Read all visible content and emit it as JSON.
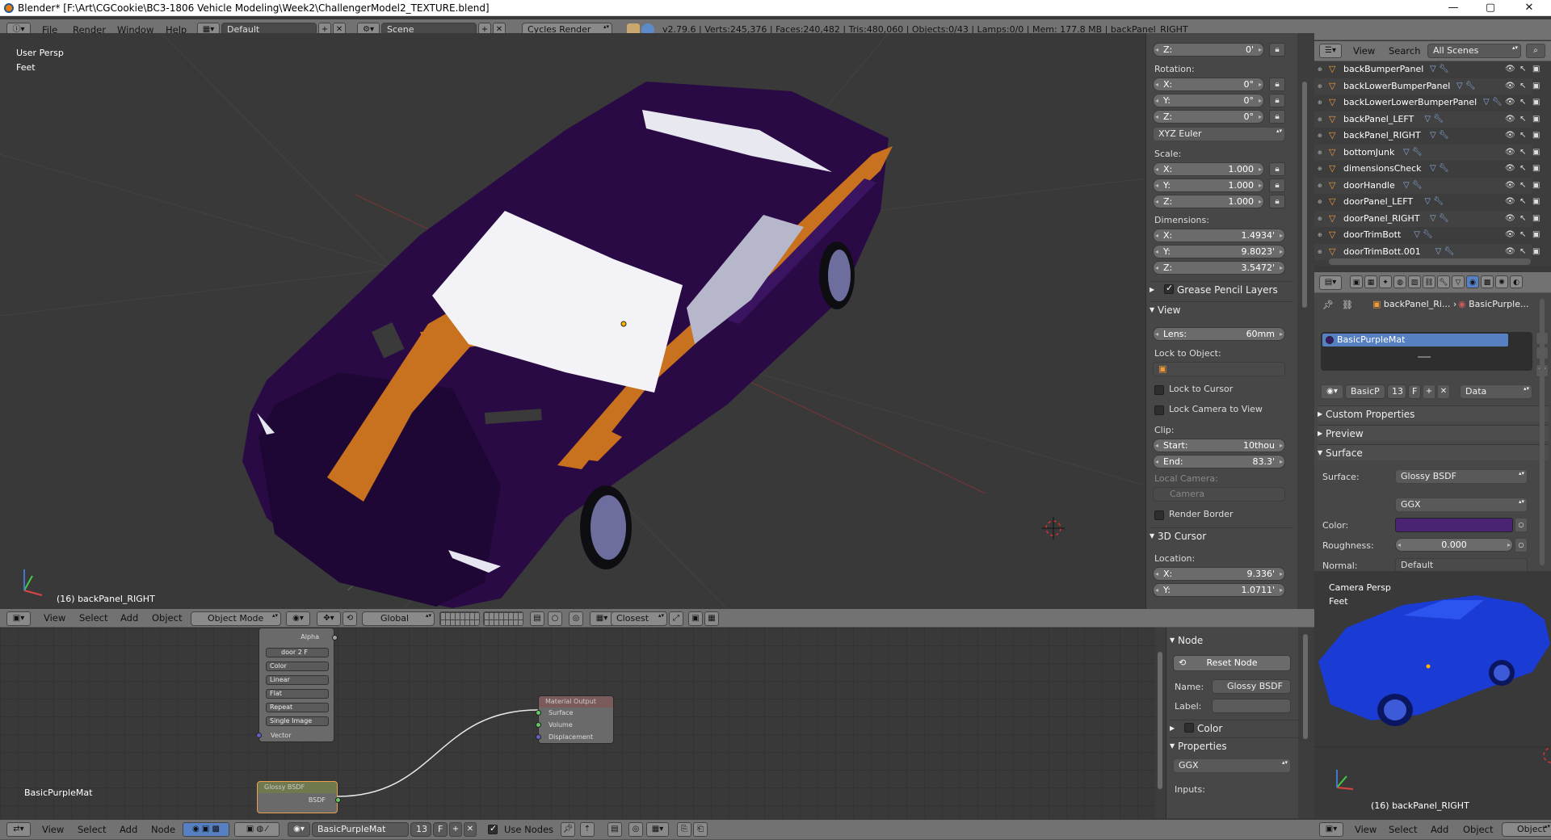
{
  "window": {
    "title": "Blender* [F:\\Art\\CGCookie\\BC3-1806 Vehicle Modeling\\Week2\\ChallengerModel2_TEXTURE.blend]",
    "controls": {
      "min": "—",
      "max": "▢",
      "close": "✕"
    }
  },
  "info_header": {
    "menus": [
      "File",
      "Render",
      "Window",
      "Help"
    ],
    "layout": "Default",
    "scene": "Scene",
    "engine": "Cycles Render",
    "stats": "v2.79.6 | Verts:245,376 | Faces:240,482 | Tris:480,060 | Objects:0/43 | Lamps:0/0 | Mem: 177.8 MB | backPanel_RIGHT"
  },
  "viewport": {
    "view_name": "User Persp",
    "units": "Feet",
    "object_label": "(16) backPanel_RIGHT",
    "header": {
      "menus": [
        "View",
        "Select",
        "Add",
        "Object"
      ],
      "mode": "Object Mode",
      "orientation": "Global",
      "snap_target": "Closest"
    }
  },
  "npanel": {
    "location_z": {
      "axis": "Z:",
      "value": "0'"
    },
    "rotation_label": "Rotation:",
    "rotation": [
      {
        "axis": "X:",
        "value": "0°"
      },
      {
        "axis": "Y:",
        "value": "0°"
      },
      {
        "axis": "Z:",
        "value": "0°"
      }
    ],
    "rotation_mode": "XYZ Euler",
    "scale_label": "Scale:",
    "scale": [
      {
        "axis": "X:",
        "value": "1.000"
      },
      {
        "axis": "Y:",
        "value": "1.000"
      },
      {
        "axis": "Z:",
        "value": "1.000"
      }
    ],
    "dimensions_label": "Dimensions:",
    "dimensions": [
      {
        "axis": "X:",
        "value": "1.4934'"
      },
      {
        "axis": "Y:",
        "value": "9.8023'"
      },
      {
        "axis": "Z:",
        "value": "3.5472'"
      }
    ],
    "grease_pencil": "Grease Pencil Layers",
    "view_section": "View",
    "lens": {
      "label": "Lens:",
      "value": "60mm"
    },
    "lock_to_object": "Lock to Object:",
    "lock_to_cursor": "Lock to Cursor",
    "lock_camera": "Lock Camera to View",
    "clip_label": "Clip:",
    "clip_start": {
      "label": "Start:",
      "value": "10thou"
    },
    "clip_end": {
      "label": "End:",
      "value": "83.3'"
    },
    "local_camera": "Local Camera:",
    "camera": "Camera",
    "render_border": "Render Border",
    "cursor_section": "3D Cursor",
    "location_label": "Location:",
    "cursor_x": {
      "axis": "X:",
      "value": "9.336'"
    },
    "cursor_y": {
      "axis": "Y:",
      "value": "1.0711'"
    }
  },
  "outliner": {
    "menus": [
      "View",
      "Search"
    ],
    "filter": "All Scenes",
    "items": [
      "backBumperPanel",
      "backLowerBumperPanel",
      "backLowerLowerBumperPanel",
      "backPanel_LEFT",
      "backPanel_RIGHT",
      "bottomJunk",
      "dimensionsCheck",
      "doorHandle",
      "doorPanel_LEFT",
      "doorPanel_RIGHT",
      "doorTrimBott",
      "doorTrimBott.001"
    ]
  },
  "properties": {
    "breadcrumb_object": "backPanel_Ri...",
    "breadcrumb_material": "BasicPurple...",
    "material_slot": "BasicPurpleMat",
    "material_short": "BasicP",
    "users": "13",
    "fake": "F",
    "link": "Data",
    "custom_props": "Custom Properties",
    "preview": "Preview",
    "surface_section": "Surface",
    "surface_label": "Surface:",
    "surface_value": "Glossy BSDF",
    "distribution": "GGX",
    "color_label": "Color:",
    "color_hex": "#4a2372",
    "roughness_label": "Roughness:",
    "roughness_value": "0.000",
    "normal_label": "Normal:",
    "normal_value": "Default"
  },
  "camview": {
    "view_name": "Camera Persp",
    "units": "Feet",
    "object_label": "(16) backPanel_RIGHT",
    "menus": [
      "View",
      "Select",
      "Add",
      "Object"
    ],
    "mode": "Object"
  },
  "node_editor": {
    "material_label": "BasicPurpleMat",
    "texture_node": {
      "alpha": "Alpha",
      "image": "door",
      "users": "2",
      "fake": "F",
      "options": [
        "Color",
        "Linear",
        "Flat",
        "Repeat",
        "Single Image"
      ],
      "vector": "Vector"
    },
    "output_node": {
      "title": "Material Output",
      "sockets": [
        "Surface",
        "Volume",
        "Displacement"
      ]
    },
    "glossy_node": {
      "title": "Glossy BSDF",
      "socket": "BSDF"
    },
    "header": {
      "menus": [
        "View",
        "Select",
        "Add",
        "Node"
      ],
      "material": "BasicPurpleMat",
      "users": "13",
      "fake": "F",
      "use_nodes": "Use Nodes"
    },
    "panel": {
      "node_section": "Node",
      "reset": "Reset Node",
      "name_label": "Name:",
      "name_value": "Glossy BSDF",
      "label_label": "Label:",
      "color_section": "Color",
      "properties_section": "Properties",
      "distribution": "GGX",
      "inputs": "Inputs:"
    }
  },
  "colors": {
    "car_body": "#2a0a45",
    "stripe": "#c8711e",
    "selection_blue": "#5680c2",
    "cam_car": "#1a3bd4"
  }
}
